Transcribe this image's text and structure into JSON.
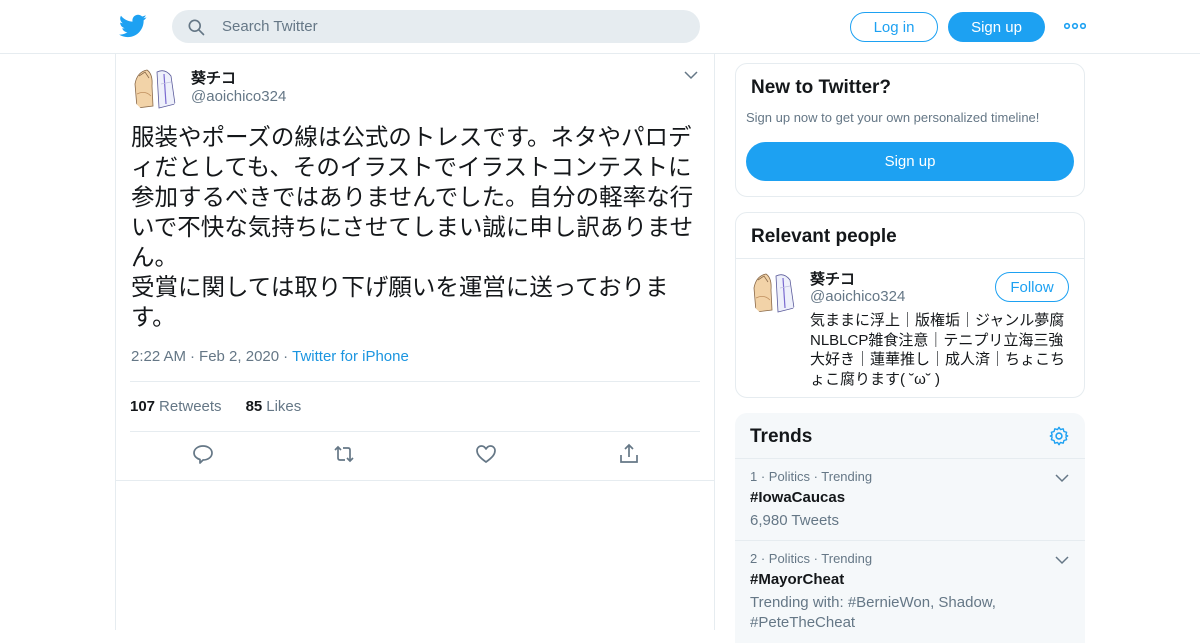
{
  "header": {
    "search_placeholder": "Search Twitter",
    "login_label": "Log in",
    "signup_label": "Sign up",
    "brand_color": "#1da1f2"
  },
  "tweet": {
    "display_name": "葵チコ",
    "handle": "@aoichico324",
    "text": "服装やポーズの線は公式のトレスです。ネタやパロディだとしても、そのイラストでイラストコンテストに参加するべきではありませんでした。自分の軽率な行いで不快な気持ちにさせてしまい誠に申し訳ありません。\n受賞に関しては取り下げ願いを運営に送っております。",
    "time": "2:22 AM",
    "date": "Feb 2, 2020",
    "source": "Twitter for iPhone",
    "retweets_count": "107",
    "retweets_label": "Retweets",
    "likes_count": "85",
    "likes_label": "Likes"
  },
  "new_to_twitter": {
    "title": "New to Twitter?",
    "subtitle": "Sign up now to get your own personalized timeline!",
    "signup_label": "Sign up"
  },
  "relevant_people": {
    "title": "Relevant people",
    "person": {
      "name": "葵チコ",
      "handle": "@aoichico324",
      "follow_label": "Follow",
      "bio": "気ままに浮上｜版権垢｜ジャンル夢腐 NLBLCP雑食注意｜テニプリ立海三強大好き｜蓮華推し｜成人済｜ちょこちょこ腐ります( ˘ω˘ )"
    }
  },
  "trends": {
    "title": "Trends",
    "items": [
      {
        "meta": "1 · Politics · Trending",
        "name": "#IowaCaucas",
        "detail": "6,980 Tweets"
      },
      {
        "meta": "2 · Politics · Trending",
        "name": "#MayorCheat",
        "detail": "Trending with: #BernieWon, Shadow, #PeteTheCheat"
      }
    ]
  }
}
